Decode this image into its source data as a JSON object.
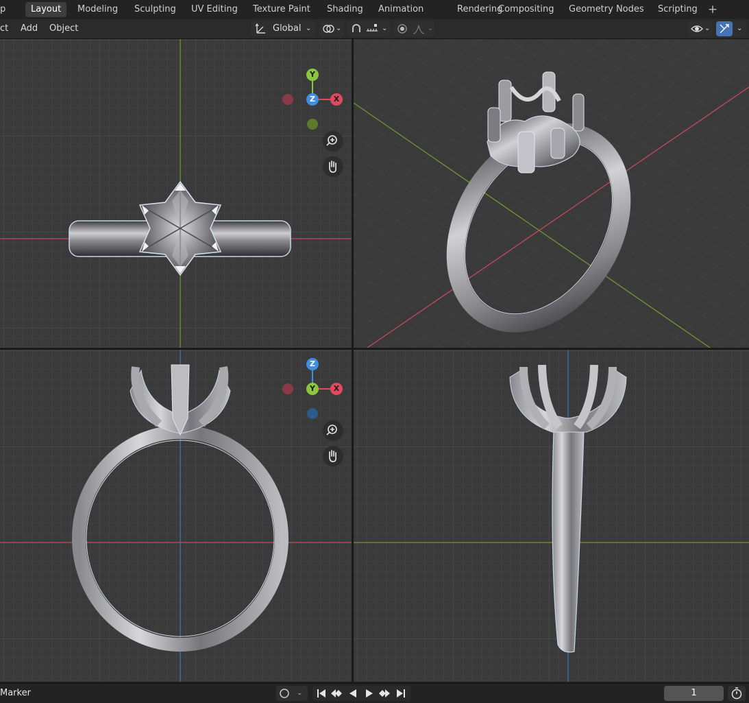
{
  "workspace_tabs": {
    "first_partial": "p",
    "items": [
      "Layout",
      "Modeling",
      "Sculpting",
      "UV Editing",
      "Texture Paint",
      "Shading",
      "Animation",
      "Rendering",
      "Compositing",
      "Geometry Nodes",
      "Scripting"
    ],
    "active": "Layout",
    "add_icon": "plus-icon"
  },
  "header": {
    "menus": [
      "ct",
      "Add",
      "Object"
    ],
    "transform_orientation": "Global",
    "icons": [
      "orientation-icon",
      "pivot-icon",
      "snap-icon",
      "snap-increment-icon",
      "proportional-edit-icon",
      "falloff-icon",
      "visibility-icon",
      "gizmo-icon"
    ]
  },
  "viewports": {
    "top_left": {
      "gizmo_labels": [
        "Y",
        "Z",
        "X"
      ],
      "axes": "top"
    },
    "top_right": {
      "axes": "perspective"
    },
    "bottom_left": {
      "gizmo_labels": [
        "Z",
        "Y",
        "X"
      ],
      "axes": "front"
    },
    "bottom_right": {
      "axes": "side"
    },
    "nav_icons": [
      "zoom-icon",
      "pan-hand-icon"
    ]
  },
  "timeline": {
    "marker_label": "Marker",
    "current_frame": "1",
    "playback_icons": [
      "jump-start-icon",
      "prev-keyframe-icon",
      "play-reverse-icon",
      "play-icon",
      "next-keyframe-icon",
      "jump-end-icon"
    ]
  },
  "colors": {
    "axis_x": "#e04a5f",
    "axis_y": "#8cc63f",
    "axis_z": "#3f8ee0",
    "active_blue": "#4772b3",
    "viewport_bg": "#3a3a3a"
  }
}
